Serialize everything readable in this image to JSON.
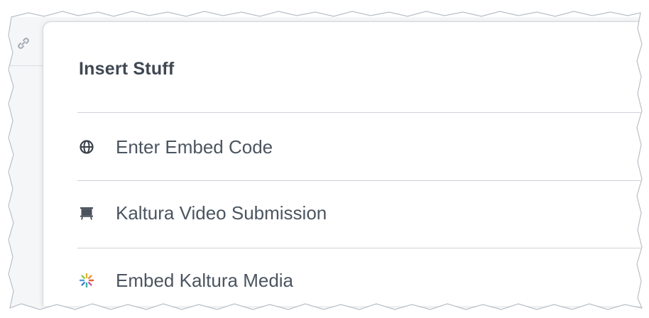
{
  "dialog": {
    "title": "Insert Stuff",
    "items": [
      {
        "label": "Enter Embed Code",
        "icon": "globe-icon"
      },
      {
        "label": "Kaltura Video Submission",
        "icon": "easel-icon"
      },
      {
        "label": "Embed Kaltura Media",
        "icon": "kaltura-pinwheel-icon"
      }
    ]
  },
  "background": {
    "icon": "link-icon"
  },
  "colors": {
    "title": "#3f4852",
    "text": "#4b5560",
    "divider": "#cdd3d9",
    "icon_dark": "#3a4049"
  }
}
